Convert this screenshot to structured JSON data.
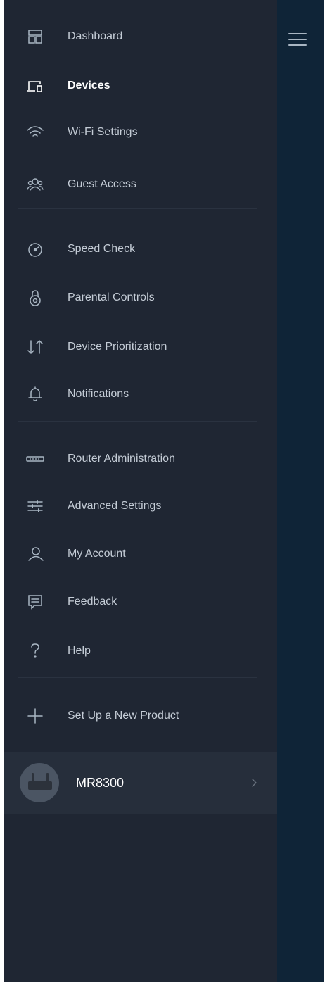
{
  "colors": {
    "drawer_bg": "#1f2633",
    "right_pane_bg": "#0f2437",
    "text": "#c4ccd6",
    "active_text": "#ffffff",
    "icon": "#a9b6c3"
  },
  "header": {
    "menu_icon": "hamburger-icon"
  },
  "menu": {
    "items": [
      {
        "label": "Dashboard",
        "icon": "dashboard-icon",
        "active": false
      },
      {
        "label": "Devices",
        "icon": "devices-icon",
        "active": true
      },
      {
        "label": "Wi-Fi Settings",
        "icon": "wifi-icon",
        "active": false
      },
      {
        "label": "Guest Access",
        "icon": "guest-icon",
        "active": false
      },
      {
        "label": "Speed Check",
        "icon": "speed-icon",
        "active": false
      },
      {
        "label": "Parental Controls",
        "icon": "parental-icon",
        "active": false
      },
      {
        "label": "Device Prioritization",
        "icon": "priority-icon",
        "active": false
      },
      {
        "label": "Notifications",
        "icon": "bell-icon",
        "active": false
      },
      {
        "label": "Router Administration",
        "icon": "router-icon",
        "active": false
      },
      {
        "label": "Advanced Settings",
        "icon": "sliders-icon",
        "active": false
      },
      {
        "label": "My Account",
        "icon": "user-icon",
        "active": false
      },
      {
        "label": "Feedback",
        "icon": "feedback-icon",
        "active": false
      },
      {
        "label": "Help",
        "icon": "help-icon",
        "active": false
      },
      {
        "label": "Set Up a New Product",
        "icon": "plus-icon",
        "active": false
      }
    ]
  },
  "product": {
    "name": "MR8300",
    "icon": "chevron-right-icon"
  }
}
